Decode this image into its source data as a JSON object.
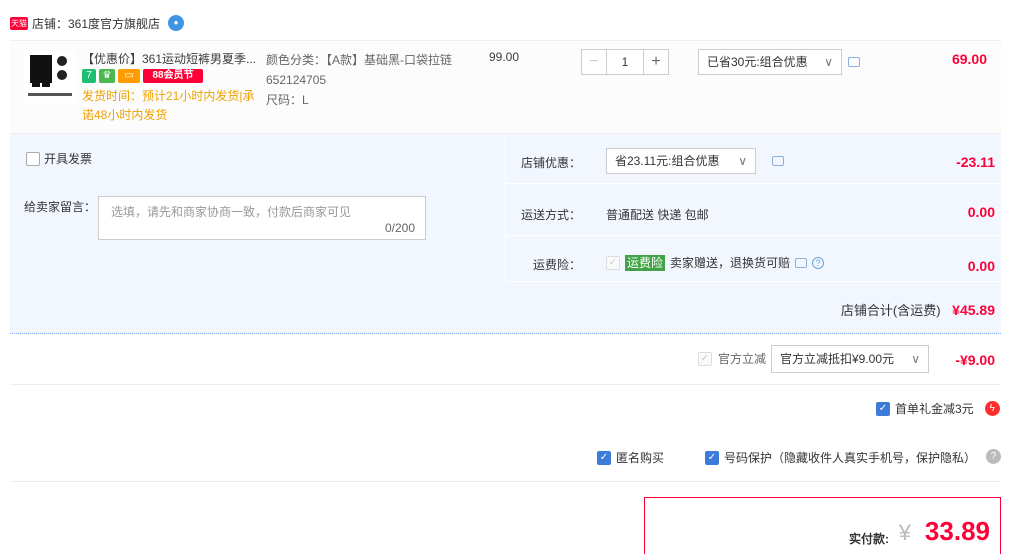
{
  "shop": {
    "badge": "天猫",
    "name": "店铺：361度官方旗舰店"
  },
  "item": {
    "title": "【优惠价】361运动短裤男夏季...",
    "badges": {
      "seven": "7",
      "shield": "♛",
      "card": "▭",
      "festival": "88会员节"
    },
    "shipping": "发货时间：预计21小时内发货|承诺48小时内发货",
    "sku_color": "颜色分类：【A款】基础黑-口袋拉链652124705",
    "sku_size": "尺码：L",
    "unit_price": "99.00",
    "quantity": "1",
    "minus": "−",
    "plus": "+",
    "promo": "已省30元:组合优惠",
    "total": "69.00"
  },
  "order": {
    "invoice_label": "开具发票",
    "note_label": "给卖家留言：",
    "note_placeholder": "选填，请先和商家协商一致，付款后商家可见",
    "note_count": "0/200",
    "shop_coupon_label": "店铺优惠：",
    "shop_coupon_value": "省23.11元:组合优惠",
    "shop_coupon_amount": "-23.11",
    "shipping_label": "运送方式：",
    "shipping_value": "普通配送 快递 包邮",
    "shipping_amount": "0.00",
    "insurance_label": "运费险：",
    "insurance_tag": "运费险",
    "insurance_text": "卖家赠送，退换货可赔",
    "insurance_amount": "0.00",
    "subtotal_label": "店铺合计(含运费)",
    "subtotal_amount": "¥45.89"
  },
  "official": {
    "label": "官方立减",
    "select": "官方立减抵扣¥9.00元",
    "amount": "-¥9.00"
  },
  "first_order": {
    "label": "首单礼金减3元",
    "bolt": "ϟ"
  },
  "privacy": {
    "anonymous": "匿名购买",
    "number_protect": "号码保护（隐藏收件人真实手机号，保护隐私）",
    "help": "?"
  },
  "pay": {
    "label": "实付款:",
    "currency": "¥",
    "amount": "33.89"
  },
  "colors": {
    "accent": "#ff0036",
    "panel": "#f2f7ff",
    "checkbox": "#3d7bd9"
  }
}
